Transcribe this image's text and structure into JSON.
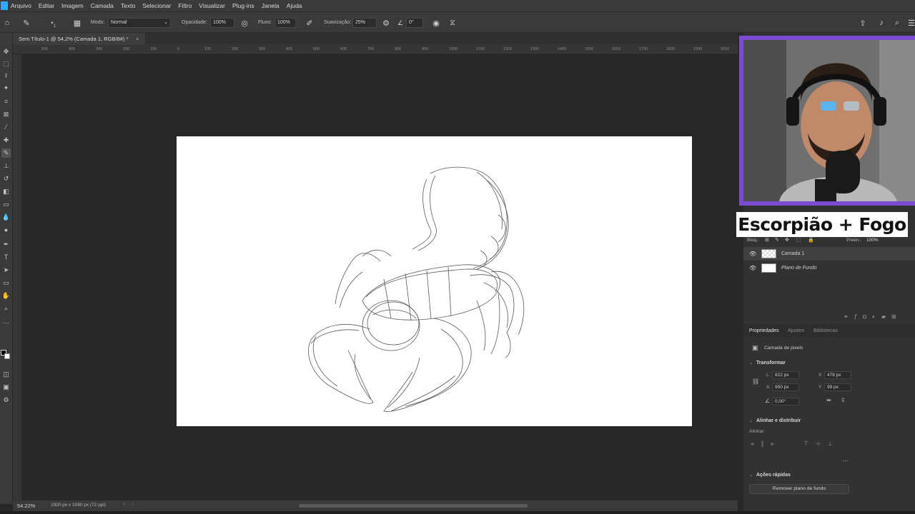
{
  "menu": [
    "Arquivo",
    "Editar",
    "Imagem",
    "Camada",
    "Texto",
    "Selecionar",
    "Filtro",
    "Visualizar",
    "Plug-ins",
    "Janela",
    "Ajuda"
  ],
  "options": {
    "mode_label": "Modo:",
    "mode_value": "Normal",
    "opacity_label": "Opacidade:",
    "opacity_value": "100%",
    "flow_label": "Fluxo:",
    "flow_value": "100%",
    "smoothing_label": "Suavização:",
    "smoothing_value": "25%",
    "angle_value": "0°",
    "brush_size": "1"
  },
  "document_tab": "Sem Título-1 @ 54,2% (Camada 1, RGB/8#) *",
  "ruler_ticks": [
    "500",
    "400",
    "300",
    "200",
    "100",
    "0",
    "100",
    "200",
    "300",
    "400",
    "500",
    "600",
    "700",
    "800",
    "900",
    "1000",
    "1100",
    "1200",
    "1300",
    "1400",
    "1500",
    "1600",
    "1700",
    "1800",
    "1900",
    "2000"
  ],
  "status": {
    "zoom": "54.22%",
    "doc_info": "1920 px x 1080 px (72 ppi)"
  },
  "layers_panel": {
    "lock_label": "Bloq.:",
    "fill_label": "Preen.:",
    "fill_value": "100%",
    "layers": [
      {
        "name": "Camada 1",
        "italic": false
      },
      {
        "name": "Plano de Fundo",
        "italic": true
      }
    ]
  },
  "properties": {
    "tabs": [
      "Propriedades",
      "Ajustes",
      "Bibliotecas"
    ],
    "pixel_layer_label": "Camada de pixels",
    "transform_title": "Transformar",
    "w_label": "L",
    "w_value": "822 px",
    "h_label": "A",
    "h_value": "950 px",
    "x_label": "X",
    "x_value": "478 px",
    "y_label": "Y",
    "y_value": "99 px",
    "angle_value": "0,00°",
    "align_title": "Alinhar e distribuir",
    "align_label": "Alinhar:",
    "quick_actions_title": "Ações rápidas",
    "remove_bg_button": "Remover plano de fundo"
  },
  "overlay_caption": "Escorpião + Fogo",
  "colors": {
    "accent": "#31a8ff",
    "webcam_border": "#7c4bd2"
  }
}
